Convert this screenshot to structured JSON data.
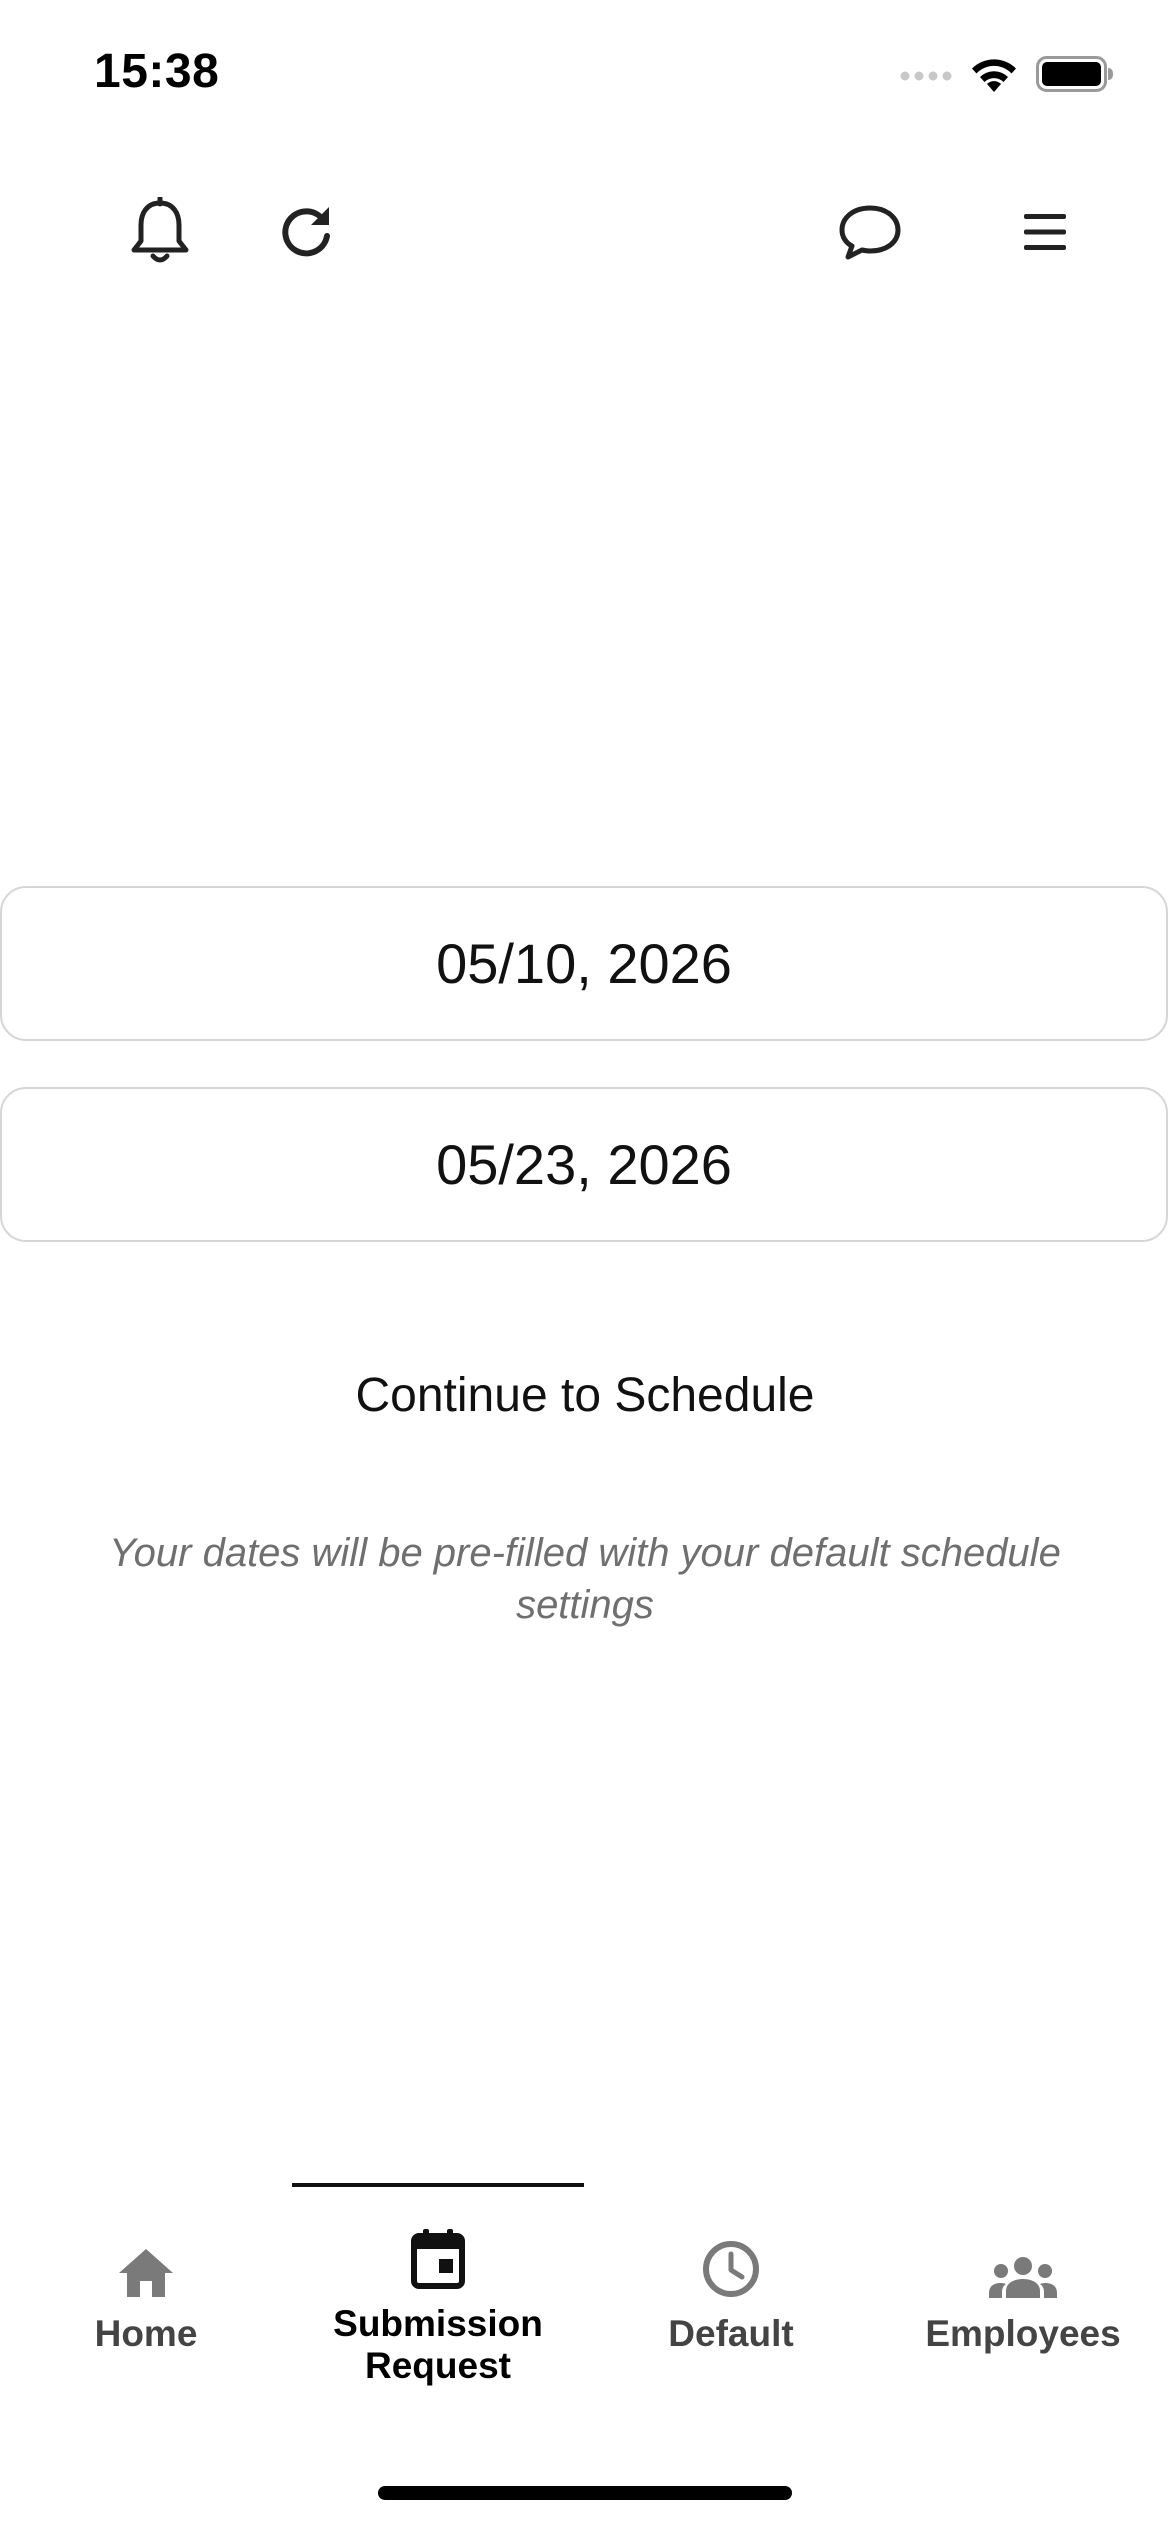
{
  "status_bar": {
    "time": "15:38"
  },
  "toolbar": {
    "icons": [
      "bell-icon",
      "refresh-icon",
      "chat-bubble-icon",
      "menu-icon"
    ]
  },
  "date_range": {
    "start_date": "05/10, 2026",
    "end_date": "05/23, 2026"
  },
  "actions": {
    "continue_label": "Continue to Schedule"
  },
  "hint": {
    "text": "Your dates will be pre-filled with your default schedule settings"
  },
  "tab_bar": {
    "active_tab": "Submission Request",
    "tabs": [
      {
        "label": "Home",
        "icon": "home-icon"
      },
      {
        "label": "Submission Request",
        "icon": "calendar-icon"
      },
      {
        "label": "Default",
        "icon": "clock-icon"
      },
      {
        "label": "Employees",
        "icon": "people-icon"
      }
    ]
  },
  "colors": {
    "active": "#000000",
    "inactive_icon": "#7a7a7a",
    "hint_text": "#6f6f6f",
    "field_border": "#d6d6d6"
  }
}
